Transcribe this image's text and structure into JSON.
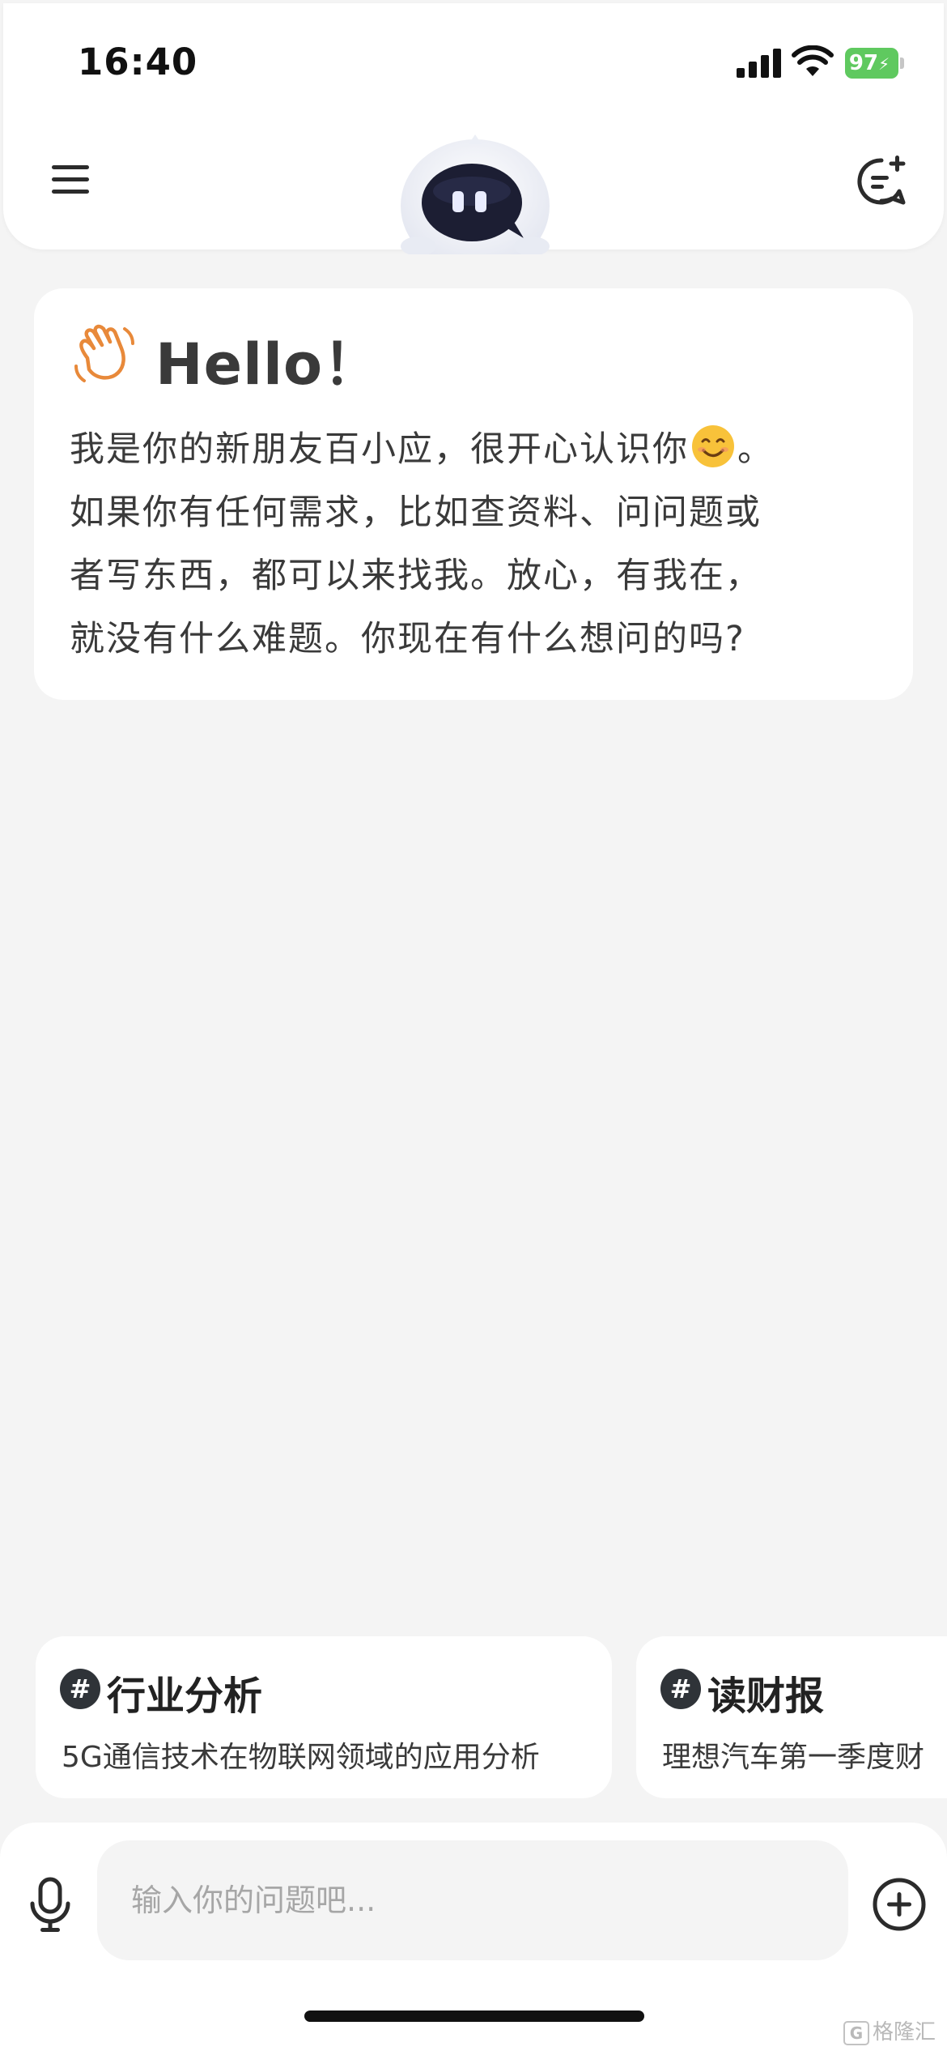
{
  "status_bar": {
    "time": "16:40",
    "battery": "97",
    "icons": [
      "signal-icon",
      "wifi-icon",
      "battery-charging-icon"
    ]
  },
  "header": {
    "menu_icon": "hamburger-menu-icon",
    "avatar": "robot-mascot",
    "new_chat_icon": "new-chat-icon"
  },
  "greeting": {
    "icon": "waving-hand-icon",
    "title": "Hello！",
    "line1_before_emoji": "我是你的新朋友百小应，很开心认识你",
    "line1_after_emoji": "。",
    "line2": "如果你有任何需求，比如查资料、问问题或",
    "line3": "者写东西，都可以来找我。放心，有我在，",
    "line4": "就没有什么难题。你现在有什么想问的吗?",
    "emoji": "smiling-face-emoji"
  },
  "suggestions": [
    {
      "hash": "#",
      "title": "行业分析",
      "description": "5G通信技术在物联网领域的应用分析"
    },
    {
      "hash": "#",
      "title": "读财报",
      "description": "理想汽车第一季度财"
    }
  ],
  "input_bar": {
    "placeholder": "输入你的问题吧...",
    "mic_icon": "microphone-icon",
    "plus_icon": "plus-circle-icon"
  },
  "watermark": {
    "logo_letter": "G",
    "text": "格隆汇"
  },
  "colors": {
    "background": "#f4f4f4",
    "card": "#ffffff",
    "text": "#3a3a3a",
    "battery": "#5fc95f",
    "wave_icon": "#e8893a"
  }
}
